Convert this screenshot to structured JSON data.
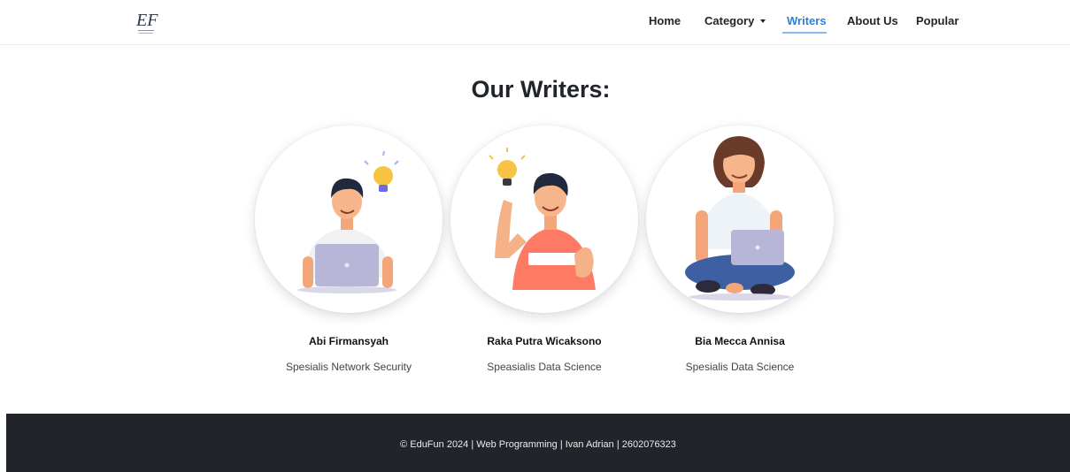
{
  "brand": {
    "logo_text": "EF"
  },
  "nav": {
    "home": "Home",
    "category": "Category",
    "writers": "Writers",
    "about": "About Us",
    "popular": "Popular",
    "active": "writers",
    "accent_color": "#2f7de1"
  },
  "page": {
    "title": "Our Writers:"
  },
  "writers": [
    {
      "name": "Abi Firmansyah",
      "role": "Spesialis Network Security"
    },
    {
      "name": "Raka Putra Wicaksono",
      "role": "Speasialis Data Science"
    },
    {
      "name": "Bia Mecca Annisa",
      "role": "Spesialis Data Science"
    }
  ],
  "footer": {
    "text": "© EduFun 2024 | Web Programming | Ivan Adrian | 2602076323"
  }
}
